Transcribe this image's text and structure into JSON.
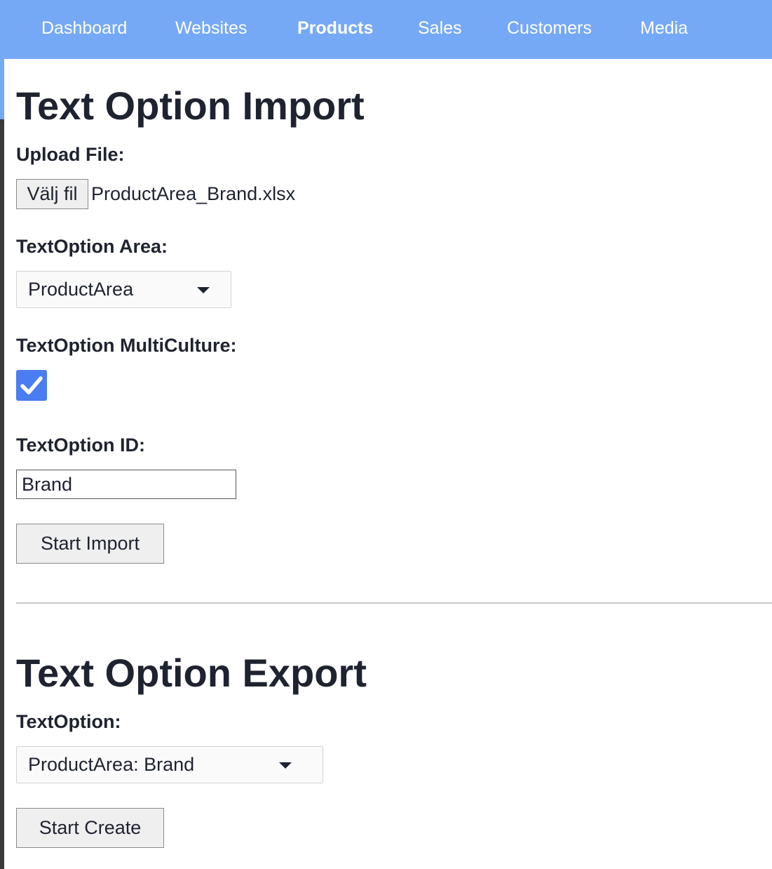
{
  "nav": {
    "items": [
      {
        "label": "Dashboard"
      },
      {
        "label": "Websites"
      },
      {
        "label": "Products"
      },
      {
        "label": "Sales"
      },
      {
        "label": "Customers"
      },
      {
        "label": "Media"
      }
    ],
    "active": "Products"
  },
  "import": {
    "title": "Text Option Import",
    "upload_label": "Upload File:",
    "file_button_label": "Välj fil",
    "file_name": "ProductArea_Brand.xlsx",
    "area_label": "TextOption Area:",
    "area_value": "ProductArea",
    "multiculture_label": "TextOption MultiCulture:",
    "multiculture_checked": true,
    "id_label": "TextOption ID:",
    "id_value": "Brand",
    "start_button": "Start Import"
  },
  "export": {
    "title": "Text Option Export",
    "option_label": "TextOption:",
    "option_value": "ProductArea: Brand",
    "start_button": "Start Create"
  },
  "colors": {
    "nav_bg": "#76a9f5",
    "checkbox": "#4a7df0",
    "text": "#1f2330"
  },
  "icons": {
    "dropdown": "chevron-down-icon",
    "checkbox": "checkmark-icon"
  }
}
